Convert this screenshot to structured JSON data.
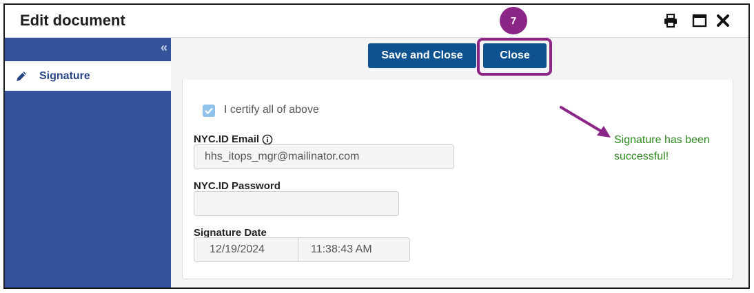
{
  "window": {
    "title": "Edit document"
  },
  "controls": {
    "print": "printer-icon",
    "maximize": "maximize-icon",
    "close": "close-icon"
  },
  "sidebar": {
    "collapse_label": "«",
    "items": [
      {
        "label": "Signature",
        "icon": "pencil-icon"
      }
    ]
  },
  "toolbar": {
    "save_close_label": "Save and Close",
    "close_label": "Close"
  },
  "annotation": {
    "step": "7",
    "message": "Signature has been successful!",
    "color": "#8b2586"
  },
  "form": {
    "certify_label": "I certify all of above",
    "certify_checked": true,
    "email_label": "NYC.ID Email",
    "email_value": "hhs_itops_mgr@mailinator.com",
    "password_label": "NYC.ID Password",
    "password_value": "",
    "date_label": "Signature Date",
    "date_value": "12/19/2024",
    "time_value": "11:38:43 AM"
  },
  "colors": {
    "sidebar": "#34529a",
    "button": "#0f5290",
    "success": "#2e8a1d"
  }
}
